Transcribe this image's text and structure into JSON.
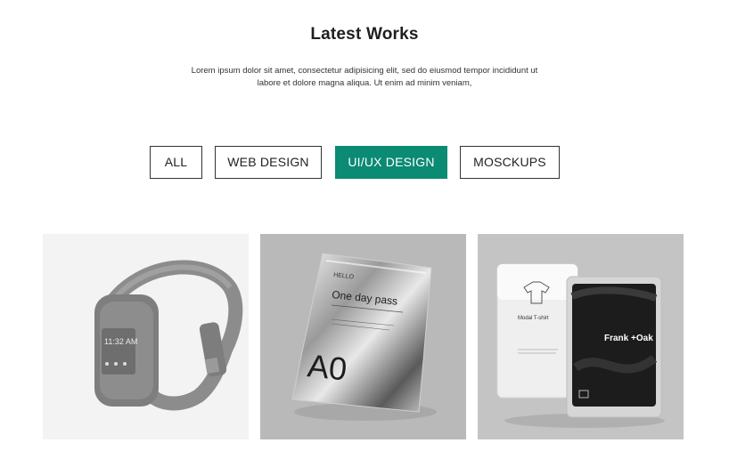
{
  "section": {
    "title": "Latest Works",
    "description": "Lorem ipsum dolor sit amet, consectetur adipisicing elit, sed do eiusmod tempor incididunt ut labore et dolore magna aliqua. Ut enim ad minim veniam,"
  },
  "filters": [
    {
      "label": "ALL",
      "active": false
    },
    {
      "label": "WEB DESIGN",
      "active": false
    },
    {
      "label": "UI/UX DESIGN",
      "active": true
    },
    {
      "label": "MOSCKUPS",
      "active": false
    }
  ],
  "colors": {
    "accent": "#0b8a74"
  },
  "works": [
    {
      "image": "fitness-tracker-icon",
      "image_text": [
        "11:32 AM"
      ]
    },
    {
      "image": "foil-pouch-icon",
      "image_text": [
        "HELLO",
        "One day pass",
        "A0"
      ]
    },
    {
      "image": "tshirt-box-icon",
      "image_text": [
        "Modal T-shirt",
        "Frank +Oak"
      ]
    }
  ]
}
